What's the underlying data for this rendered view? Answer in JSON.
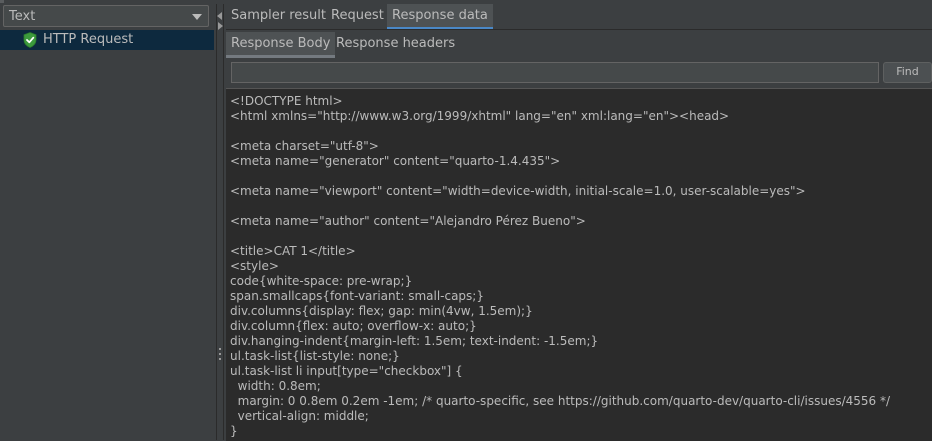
{
  "renderer": {
    "selected": "Text"
  },
  "tree": {
    "items": [
      {
        "label": "HTTP Request",
        "status": "success",
        "icon": "shield-check-icon"
      }
    ]
  },
  "result_tabs": [
    {
      "label": "Sampler result",
      "active": false
    },
    {
      "label": "Request",
      "active": false
    },
    {
      "label": "Response data",
      "active": true
    }
  ],
  "response_tabs": [
    {
      "label": "Response Body",
      "active": true
    },
    {
      "label": "Response headers",
      "active": false
    }
  ],
  "search": {
    "value": "",
    "placeholder": "",
    "button_label": "Find"
  },
  "response_body": "<!DOCTYPE html>\n<html xmlns=\"http://www.w3.org/1999/xhtml\" lang=\"en\" xml:lang=\"en\"><head>\n\n<meta charset=\"utf-8\">\n<meta name=\"generator\" content=\"quarto-1.4.435\">\n\n<meta name=\"viewport\" content=\"width=device-width, initial-scale=1.0, user-scalable=yes\">\n\n<meta name=\"author\" content=\"Alejandro Pérez Bueno\">\n\n<title>CAT 1</title>\n<style>\ncode{white-space: pre-wrap;}\nspan.smallcaps{font-variant: small-caps;}\ndiv.columns{display: flex; gap: min(4vw, 1.5em);}\ndiv.column{flex: auto; overflow-x: auto;}\ndiv.hanging-indent{margin-left: 1.5em; text-indent: -1.5em;}\nul.task-list{list-style: none;}\nul.task-list li input[type=\"checkbox\"] {\n  width: 0.8em;\n  margin: 0 0.8em 0.2em -1em; /* quarto-specific, see https://github.com/quarto-dev/quarto-cli/issues/4556 */\n  vertical-align: middle;\n}",
  "colors": {
    "background": "#3c3f41",
    "text_area": "#2b2b2b",
    "selection": "#0d293e",
    "accent": "#4a88c7",
    "success": "#3c9a3c"
  }
}
